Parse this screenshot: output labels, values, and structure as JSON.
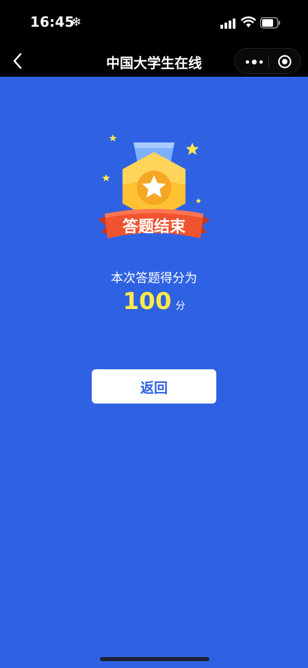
{
  "status_bar": {
    "time": "16:45",
    "extra_glyph": "❄"
  },
  "nav": {
    "title": "中国大学生在线"
  },
  "medal": {
    "ribbon_text": "答题结束"
  },
  "result": {
    "label": "本次答题得分为",
    "score": "100",
    "unit": "分"
  },
  "actions": {
    "return_label": "返回"
  },
  "colors": {
    "background": "#2f62e3",
    "score": "#ffe94a",
    "ribbon": "#f0532f",
    "medal": "#ffc235"
  }
}
